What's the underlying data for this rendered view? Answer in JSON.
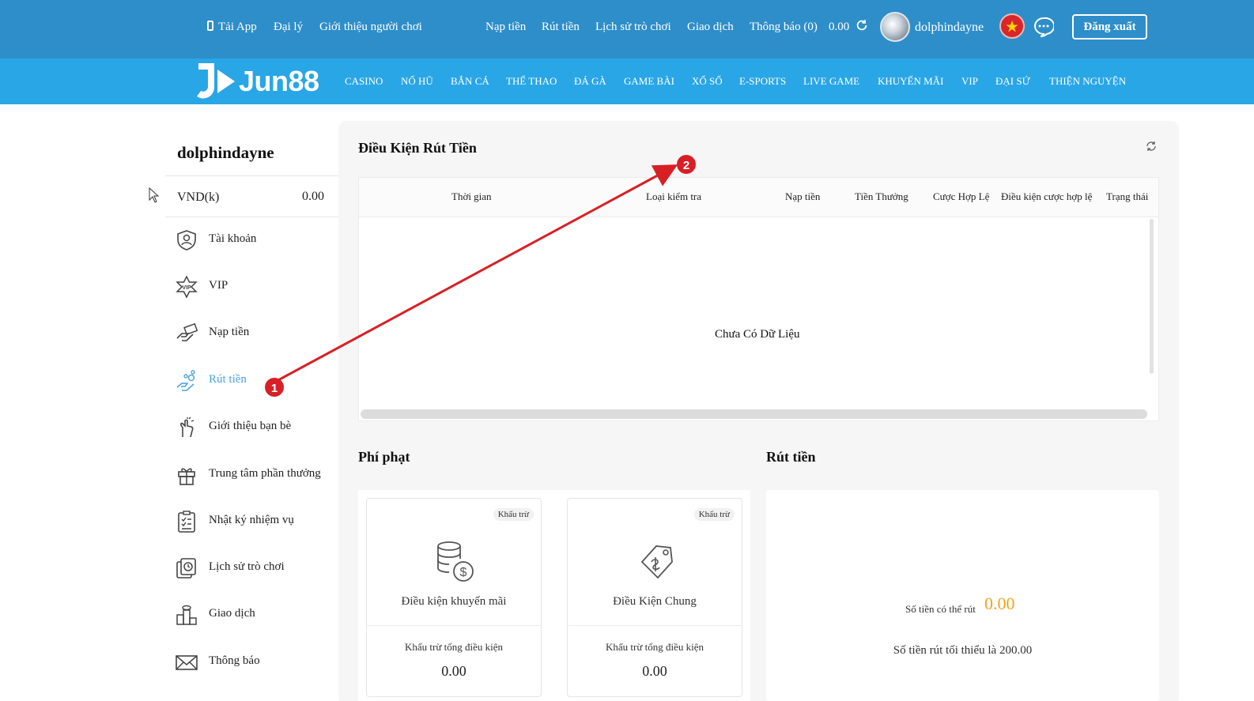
{
  "topbar": {
    "app": "Tải App",
    "agent": "Đại lý",
    "referral": "Giới thiệu người chơi",
    "deposit": "Nạp tiền",
    "withdraw": "Rút tiền",
    "game_history": "Lịch sử trò chơi",
    "transactions": "Giao dịch",
    "notifications": "Thông báo (0)",
    "balance": "0.00",
    "username": "dolphindayne",
    "logout": "Đăng xuất"
  },
  "brand": {
    "logo_text": "Jun88"
  },
  "nav": [
    "CASINO",
    "NỔ HŨ",
    "BẮN CÁ",
    "THỂ THAO",
    "ĐÁ GÀ",
    "GAME BÀI",
    "XỔ SỐ",
    "E-SPORTS",
    "LIVE GAME",
    "KHUYẾN MÃI",
    "VIP",
    "ĐẠI SỨ",
    "THIỆN NGUYỆN"
  ],
  "sidebar": {
    "username": "dolphindayne",
    "currency": "VND(k)",
    "balance": "0.00",
    "items": [
      {
        "label": "Tài khoản",
        "icon": "account-shield-icon"
      },
      {
        "label": "VIP",
        "icon": "vip-star-icon"
      },
      {
        "label": "Nạp tiền",
        "icon": "deposit-hand-icon"
      },
      {
        "label": "Rút tiền",
        "icon": "withdraw-coins-icon",
        "active": true
      },
      {
        "label": "Giới thiệu bạn bè",
        "icon": "invite-hand-icon"
      },
      {
        "label": "Trung tâm phần thưởng",
        "icon": "gift-icon"
      },
      {
        "label": "Nhật ký nhiệm vụ",
        "icon": "task-list-icon"
      },
      {
        "label": "Lịch sử trò chơi",
        "icon": "game-history-icon"
      },
      {
        "label": "Giao dịch",
        "icon": "transaction-coins-icon"
      },
      {
        "label": "Thông báo",
        "icon": "mail-icon"
      }
    ]
  },
  "conditions": {
    "title": "Điều Kiện Rút Tiền",
    "columns": [
      "Thời gian",
      "Loại kiểm tra",
      "Nạp tiền",
      "Tiền Thưởng",
      "Cược Hợp Lệ",
      "Điều kiện cược hợp lệ",
      "Trạng thái"
    ],
    "empty": "Chưa Có Dữ Liệu"
  },
  "penalty": {
    "title": "Phí phạt",
    "cards": [
      {
        "badge": "Khấu trừ",
        "name": "Điều kiện khuyến mãi",
        "sub": "Khấu trừ tổng điều kiện",
        "value": "0.00"
      },
      {
        "badge": "Khấu trừ",
        "name": "Điều Kiện Chung",
        "sub": "Khấu trừ tổng điều kiện",
        "value": "0.00"
      }
    ]
  },
  "withdraw": {
    "title": "Rút tiền",
    "available_label": "Số tiền có thể rút",
    "available_amount": "0.00",
    "minimum": "Số tiền rút tối thiểu là 200.00"
  },
  "annotations": [
    "1",
    "2"
  ],
  "colors": {
    "topbar": "#2e8ec9",
    "navbar": "#29a6e6",
    "active": "#4aa3df",
    "amount": "#f2a21c",
    "annotation": "#d91f26"
  }
}
